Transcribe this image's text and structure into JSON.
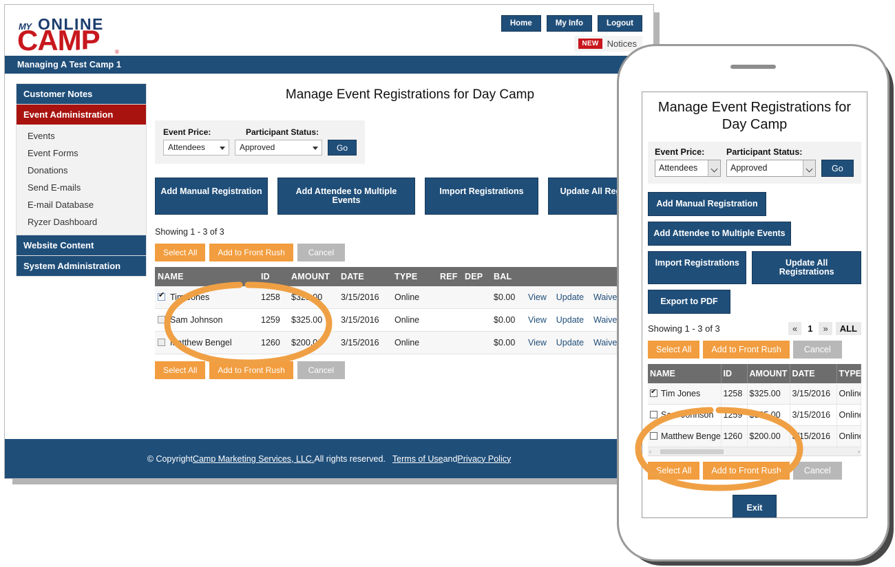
{
  "brand": {
    "logo_my": "MY",
    "logo_online": "ONLINE",
    "logo_camp": "CAMP",
    "logo_r": "®",
    "navy": "#1f4e79",
    "red": "#a8130f",
    "orange": "#f29d3f",
    "gray_header": "#6d6d6d"
  },
  "topnav": {
    "buttons": [
      {
        "label": "Home"
      },
      {
        "label": "My Info"
      },
      {
        "label": "Logout"
      }
    ],
    "notice_badge": "NEW",
    "notice_label": "Notices"
  },
  "camp_bar": {
    "title": "Managing A Test Camp 1"
  },
  "sidebar": {
    "items": [
      {
        "label": "Customer Notes",
        "type": "header"
      },
      {
        "label": "Event Administration",
        "type": "header-active"
      },
      {
        "label": "Events",
        "type": "sub"
      },
      {
        "label": "Event Forms",
        "type": "sub"
      },
      {
        "label": "Donations",
        "type": "sub"
      },
      {
        "label": "Send E-mails",
        "type": "sub"
      },
      {
        "label": "E-mail Database",
        "type": "sub"
      },
      {
        "label": "Ryzer Dashboard",
        "type": "sub"
      },
      {
        "label": "Website Content",
        "type": "header"
      },
      {
        "label": "System Administration",
        "type": "header"
      }
    ]
  },
  "main": {
    "page_title": "Manage Event Registrations for Day Camp",
    "filter": {
      "event_price_label": "Event Price:",
      "participant_status_label": "Participant Status:",
      "event_price_value": "Attendees",
      "participant_status_value": "Approved",
      "go_label": "Go"
    },
    "action_buttons": [
      {
        "label": "Add Manual Registration"
      },
      {
        "label": "Add Attendee to Multiple Events"
      },
      {
        "label": "Import Registrations"
      },
      {
        "label": "Update All Registrations"
      }
    ],
    "showing_text": "Showing 1 - 3 of 3",
    "bulk_buttons": {
      "select_all": "Select All",
      "add_to_front_rush": "Add to Front Rush",
      "cancel": "Cancel"
    },
    "table": {
      "columns": [
        "NAME",
        "ID",
        "AMOUNT",
        "DATE",
        "TYPE",
        "REF",
        "DEP",
        "BAL"
      ],
      "row_links": [
        "View",
        "Update",
        "Waivers"
      ],
      "rows": [
        {
          "name": "Tim Jones",
          "checked": true,
          "id": "1258",
          "amount": "$325.00",
          "date": "3/15/2016",
          "type": "Online",
          "ref": "",
          "dep": "",
          "bal": "$0.00"
        },
        {
          "name": "Sam Johnson",
          "checked": false,
          "id": "1259",
          "amount": "$325.00",
          "date": "3/15/2016",
          "type": "Online",
          "ref": "",
          "dep": "",
          "bal": "$0.00"
        },
        {
          "name": "Matthew Bengel",
          "checked": false,
          "id": "1260",
          "amount": "$200.00",
          "date": "3/15/2016",
          "type": "Online",
          "ref": "",
          "dep": "",
          "bal": "$0.00"
        }
      ]
    },
    "exit_label": "Exit"
  },
  "footer": {
    "copyright_prefix": "© Copyright ",
    "company": "Camp Marketing Services, LLC.",
    "rights": " All rights reserved.",
    "terms": "Terms of Use",
    "and": " and ",
    "privacy": "Privacy Policy"
  },
  "mobile": {
    "page_title": "Manage Event Registrations for Day Camp",
    "filter": {
      "event_price_label": "Event Price:",
      "participant_status_label": "Participant Status:",
      "event_price_value": "Attendees",
      "participant_status_value": "Approved",
      "go_label": "Go"
    },
    "action_buttons": [
      {
        "label": "Add Manual Registration"
      },
      {
        "label": "Add Attendee to Multiple Events"
      },
      {
        "label": "Import Registrations"
      },
      {
        "label": "Update All Registrations"
      },
      {
        "label": "Export to PDF"
      }
    ],
    "showing_text": "Showing 1 - 3 of 3",
    "pager": {
      "prev": "«",
      "page": "1",
      "next": "»",
      "all": "ALL"
    },
    "bulk_buttons": {
      "select_all": "Select All",
      "add_to_front_rush": "Add to Front Rush",
      "cancel": "Cancel"
    },
    "table": {
      "columns": [
        "NAME",
        "ID",
        "AMOUNT",
        "DATE",
        "TYPE"
      ],
      "rows": [
        {
          "name": "Tim Jones",
          "checked": true,
          "id": "1258",
          "amount": "$325.00",
          "date": "3/15/2016",
          "type": "Online"
        },
        {
          "name": "Sam Johnson",
          "checked": false,
          "id": "1259",
          "amount": "$325.00",
          "date": "3/15/2016",
          "type": "Online"
        },
        {
          "name": "Matthew Bengel",
          "checked": false,
          "id": "1260",
          "amount": "$200.00",
          "date": "3/15/2016",
          "type": "Online"
        }
      ]
    },
    "exit_label": "Exit"
  },
  "annotations": {
    "color": "#f0a044",
    "desktop_highlight": "ellipse around Select All / Add to Front Rush / Cancel buttons",
    "mobile_highlight": "ellipse around Select All / Add to Front Rush / Cancel buttons"
  }
}
